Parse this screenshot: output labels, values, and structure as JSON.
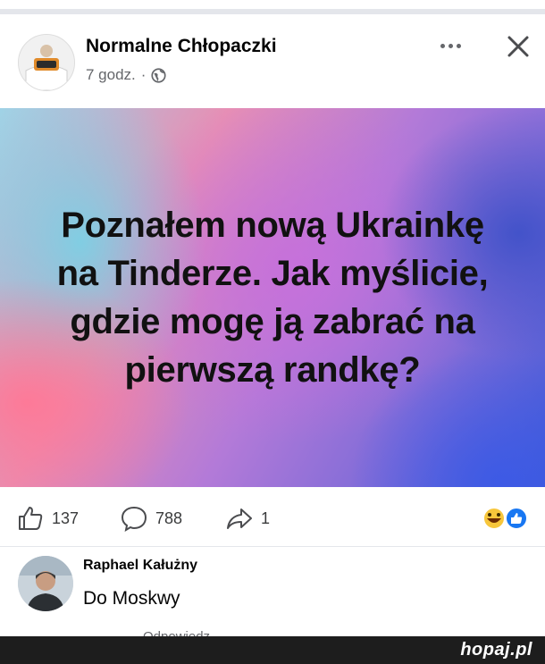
{
  "post": {
    "page_name": "Normalne Chłopaczki",
    "time": "7 godz.",
    "separator": "·",
    "text": "Poznałem nową Ukrainkę na Tinderze. Jak myślicie, gdzie mogę ją zabrać na pierwszą randkę?",
    "icons": {
      "more": "more-dots-icon",
      "close": "close-icon",
      "audience": "globe-icon"
    }
  },
  "actions": {
    "likes": "137",
    "comments": "788",
    "shares": "1",
    "icons": [
      "like-icon",
      "comment-icon",
      "share-icon",
      "reactions-icon"
    ]
  },
  "comment": {
    "author": "Raphael Kałużny",
    "text": "Do Moskwy",
    "reply_partial": "Odpowiedz"
  },
  "footer": {
    "brand": "hopaj.pl"
  },
  "colors": {
    "text": "#050505",
    "muted": "#65676b",
    "accent": "#1877f2"
  }
}
